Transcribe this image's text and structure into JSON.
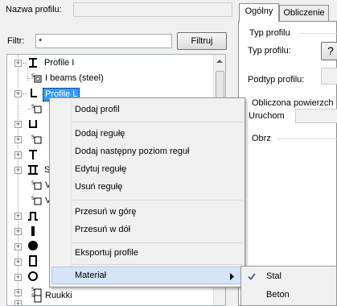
{
  "profile_name": {
    "label": "Nazwa profilu:",
    "value": ""
  },
  "filter": {
    "label": "Filtr:",
    "value": "*",
    "button": "Filtruj"
  },
  "tree": {
    "items": [
      {
        "label": "Profile I",
        "icon": "i-beam-icon"
      },
      {
        "label": "I beams (steel)",
        "icon": "library-icon"
      },
      {
        "label": "Profile L",
        "icon": "l-profile-icon",
        "selected": true
      },
      {
        "label": "",
        "icon": "library-icon"
      },
      {
        "label": "",
        "icon": "u-profile-icon"
      },
      {
        "label": "",
        "icon": "library-icon"
      },
      {
        "label": "",
        "icon": "t-profile-icon"
      },
      {
        "label": "S",
        "icon": "double-t-icon"
      },
      {
        "label": "V",
        "icon": "library-icon"
      },
      {
        "label": "V",
        "icon": "library-icon"
      },
      {
        "label": "",
        "icon": "omega-profile-icon"
      },
      {
        "label": "",
        "icon": "flat-bar-icon"
      },
      {
        "label": "",
        "icon": "round-bar-icon"
      },
      {
        "label": "",
        "icon": "rectangular-tube-icon"
      },
      {
        "label": "",
        "icon": "circular-tube-icon"
      },
      {
        "label": "",
        "icon": "library-icon"
      },
      {
        "label": "Ruukki",
        "icon": "library-icon"
      }
    ]
  },
  "tabs": [
    {
      "label": "Ogólny",
      "active": true
    },
    {
      "label": "Obliczenie",
      "active": false
    }
  ],
  "general": {
    "typ_group": "Typ profilu",
    "typ_label": "Typ profilu:",
    "help_button": "?",
    "podtyp_label": "Podtyp profilu:",
    "calc_group": "Obliczona powierzch",
    "run_label": "Uruchom",
    "obrz_group": "Obrz"
  },
  "context_menu": {
    "items": [
      "Dodaj profil",
      "Dodaj regułę",
      "Dodaj następny poziom reguł",
      "Edytuj regułę",
      "Usuń regułę",
      "Przesuń w górę",
      "Przesuń w dół",
      "Eksportuj profile",
      "Materiał"
    ]
  },
  "submenu": {
    "items": [
      {
        "label": "Stal",
        "checked": true
      },
      {
        "label": "Beton",
        "checked": false
      }
    ]
  }
}
